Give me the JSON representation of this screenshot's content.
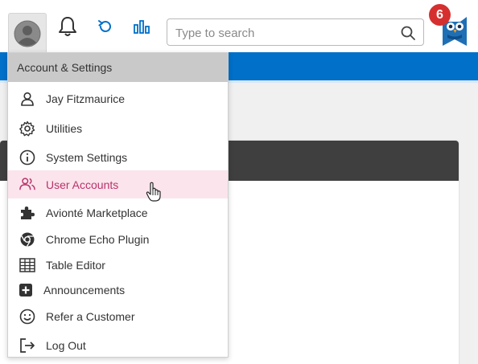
{
  "header": {
    "search": {
      "placeholder": "Type to search",
      "value": ""
    },
    "notification_count": "6",
    "icons": [
      "user-avatar",
      "bell-icon",
      "refresh-icon",
      "bar-chart-icon",
      "search-icon",
      "owl-logo"
    ]
  },
  "colors": {
    "brand_blue": "#0070c9",
    "badge_red": "#d62f2f",
    "active_pink_bg": "#fbe4ec",
    "active_pink_text": "#b8336a",
    "menu_header_bg": "#c9c9c9",
    "card_header_bg": "#3f3f3f"
  },
  "menu": {
    "title": "Account & Settings",
    "items": [
      {
        "label": "Jay Fitzmaurice",
        "icon": "user-icon"
      },
      {
        "label": "Utilities",
        "icon": "gear-icon"
      },
      {
        "label": "System Settings",
        "icon": "info-icon"
      },
      {
        "label": "User Accounts",
        "icon": "users-icon",
        "active": true
      },
      {
        "label": "Avionté Marketplace",
        "icon": "puzzle-icon"
      },
      {
        "label": "Chrome Echo Plugin",
        "icon": "chrome-icon"
      },
      {
        "label": "Table Editor",
        "icon": "table-icon"
      },
      {
        "label": "Announcements",
        "icon": "plus-square-icon"
      },
      {
        "label": "Refer a Customer",
        "icon": "smiley-icon"
      },
      {
        "label": "Log Out",
        "icon": "logout-icon"
      }
    ]
  }
}
